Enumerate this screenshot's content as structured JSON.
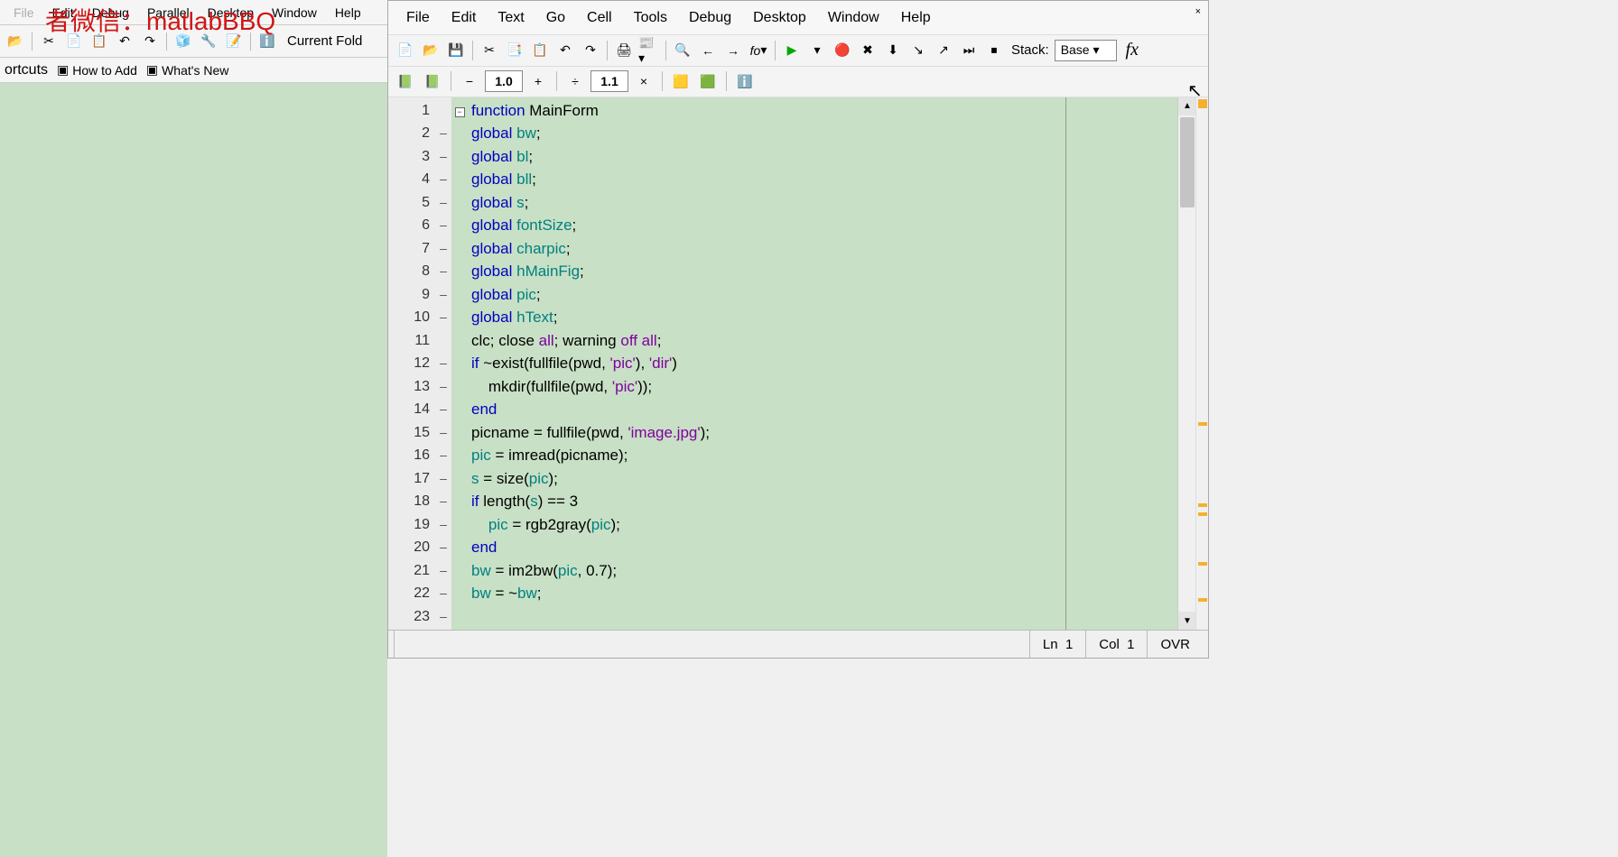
{
  "watermark": "者微信：matlabBBQ",
  "leftMenu": {
    "edit": "Edit",
    "debug": "Debug",
    "parallel": "Parallel",
    "desktop": "Desktop",
    "window": "Window",
    "help": "Help"
  },
  "leftToolbar": {
    "currentFolder": "Current Fold"
  },
  "shortcuts": {
    "bar": "ortcuts",
    "howToAdd": "How to Add",
    "whatsNew": "What's New"
  },
  "editorMenu": {
    "file": "File",
    "edit": "Edit",
    "text": "Text",
    "go": "Go",
    "cell": "Cell",
    "tools": "Tools",
    "debug": "Debug",
    "desktop": "Desktop",
    "window": "Window",
    "help": "Help"
  },
  "cellBar": {
    "val1": "1.0",
    "val2": "1.1"
  },
  "stack": {
    "label": "Stack:",
    "value": "Base"
  },
  "status": {
    "ln": "Ln",
    "lnVal": "1",
    "col": "Col",
    "colVal": "1",
    "ovr": "OVR"
  },
  "code": {
    "lines": [
      {
        "n": 1,
        "bp": "",
        "fold": true,
        "tokens": [
          {
            "t": "function ",
            "c": "kw"
          },
          {
            "t": "MainForm",
            "c": ""
          }
        ]
      },
      {
        "n": 2,
        "bp": "–",
        "tokens": [
          {
            "t": "global ",
            "c": "kw"
          },
          {
            "t": "bw",
            "c": "ident"
          },
          {
            "t": ";",
            "c": ""
          }
        ]
      },
      {
        "n": 3,
        "bp": "–",
        "tokens": [
          {
            "t": "global ",
            "c": "kw"
          },
          {
            "t": "bl",
            "c": "ident"
          },
          {
            "t": ";",
            "c": ""
          }
        ]
      },
      {
        "n": 4,
        "bp": "–",
        "tokens": [
          {
            "t": "global ",
            "c": "kw"
          },
          {
            "t": "bll",
            "c": "ident"
          },
          {
            "t": ";",
            "c": ""
          }
        ]
      },
      {
        "n": 5,
        "bp": "–",
        "tokens": [
          {
            "t": "global ",
            "c": "kw"
          },
          {
            "t": "s",
            "c": "ident"
          },
          {
            "t": ";",
            "c": ""
          }
        ]
      },
      {
        "n": 6,
        "bp": "–",
        "tokens": [
          {
            "t": "global ",
            "c": "kw"
          },
          {
            "t": "fontSize",
            "c": "ident"
          },
          {
            "t": ";",
            "c": ""
          }
        ]
      },
      {
        "n": 7,
        "bp": "–",
        "tokens": [
          {
            "t": "global ",
            "c": "kw"
          },
          {
            "t": "charpic",
            "c": "ident"
          },
          {
            "t": ";",
            "c": ""
          }
        ]
      },
      {
        "n": 8,
        "bp": "–",
        "tokens": [
          {
            "t": "global ",
            "c": "kw"
          },
          {
            "t": "hMainFig",
            "c": "ident"
          },
          {
            "t": ";",
            "c": ""
          }
        ]
      },
      {
        "n": 9,
        "bp": "–",
        "tokens": [
          {
            "t": "global ",
            "c": "kw"
          },
          {
            "t": "pic",
            "c": "ident"
          },
          {
            "t": ";",
            "c": ""
          }
        ]
      },
      {
        "n": 10,
        "bp": "–",
        "tokens": [
          {
            "t": "global ",
            "c": "kw"
          },
          {
            "t": "hText",
            "c": "ident"
          },
          {
            "t": ";",
            "c": ""
          }
        ]
      },
      {
        "n": 11,
        "bp": "",
        "tokens": [
          {
            "t": "",
            "c": ""
          }
        ]
      },
      {
        "n": 12,
        "bp": "–",
        "tokens": [
          {
            "t": "clc; close ",
            "c": ""
          },
          {
            "t": "all",
            "c": "str"
          },
          {
            "t": "; warning ",
            "c": ""
          },
          {
            "t": "off all",
            "c": "str"
          },
          {
            "t": ";",
            "c": ""
          }
        ]
      },
      {
        "n": 13,
        "bp": "–",
        "tokens": [
          {
            "t": "if ",
            "c": "kw"
          },
          {
            "t": "~exist(fullfile(pwd, ",
            "c": ""
          },
          {
            "t": "'pic'",
            "c": "str"
          },
          {
            "t": "), ",
            "c": ""
          },
          {
            "t": "'dir'",
            "c": "str"
          },
          {
            "t": ")",
            "c": ""
          }
        ]
      },
      {
        "n": 14,
        "bp": "–",
        "tokens": [
          {
            "t": "    mkdir(fullfile(pwd, ",
            "c": ""
          },
          {
            "t": "'pic'",
            "c": "str"
          },
          {
            "t": "));",
            "c": ""
          }
        ]
      },
      {
        "n": 15,
        "bp": "–",
        "tokens": [
          {
            "t": "end",
            "c": "kw"
          }
        ]
      },
      {
        "n": 16,
        "bp": "–",
        "tokens": [
          {
            "t": "picname = fullfile(pwd, ",
            "c": ""
          },
          {
            "t": "'image.jpg'",
            "c": "str"
          },
          {
            "t": ");",
            "c": ""
          }
        ]
      },
      {
        "n": 17,
        "bp": "–",
        "tokens": [
          {
            "t": "pic",
            "c": "ident"
          },
          {
            "t": " = imread(picname);",
            "c": ""
          }
        ]
      },
      {
        "n": 18,
        "bp": "–",
        "tokens": [
          {
            "t": "s",
            "c": "ident"
          },
          {
            "t": " = size(",
            "c": ""
          },
          {
            "t": "pic",
            "c": "ident"
          },
          {
            "t": ");",
            "c": ""
          }
        ]
      },
      {
        "n": 19,
        "bp": "–",
        "tokens": [
          {
            "t": "if ",
            "c": "kw"
          },
          {
            "t": "length(",
            "c": ""
          },
          {
            "t": "s",
            "c": "ident"
          },
          {
            "t": ") == 3",
            "c": ""
          }
        ]
      },
      {
        "n": 20,
        "bp": "–",
        "tokens": [
          {
            "t": "    ",
            "c": ""
          },
          {
            "t": "pic",
            "c": "ident"
          },
          {
            "t": " = rgb2gray(",
            "c": ""
          },
          {
            "t": "pic",
            "c": "ident"
          },
          {
            "t": ");",
            "c": ""
          }
        ]
      },
      {
        "n": 21,
        "bp": "–",
        "tokens": [
          {
            "t": "end",
            "c": "kw"
          }
        ]
      },
      {
        "n": 22,
        "bp": "–",
        "tokens": [
          {
            "t": "bw",
            "c": "ident"
          },
          {
            "t": " = im2bw(",
            "c": ""
          },
          {
            "t": "pic",
            "c": "ident"
          },
          {
            "t": ", 0.7);",
            "c": ""
          }
        ]
      },
      {
        "n": 23,
        "bp": "–",
        "tokens": [
          {
            "t": "bw",
            "c": "ident"
          },
          {
            "t": " = ~",
            "c": ""
          },
          {
            "t": "bw",
            "c": "ident"
          },
          {
            "t": ";",
            "c": ""
          }
        ]
      }
    ]
  },
  "markers": [
    360,
    450,
    460,
    515,
    555
  ]
}
